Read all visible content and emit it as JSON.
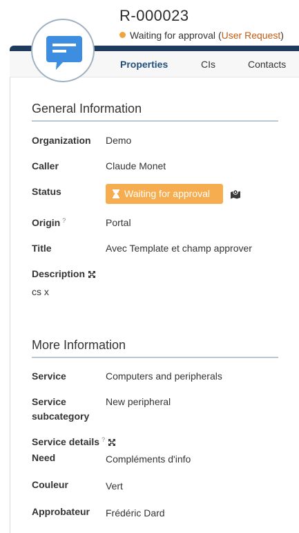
{
  "header": {
    "ref": "R-000023",
    "status_text": "Waiting for approval",
    "type_open": "(",
    "type_link": "User Request",
    "type_close": ")"
  },
  "tabs": [
    {
      "label": "Properties",
      "active": true
    },
    {
      "label": "CIs"
    },
    {
      "label": "Contacts"
    }
  ],
  "general": {
    "title": "General Information",
    "organization_label": "Organization",
    "organization_value": "Demo",
    "caller_label": "Caller",
    "caller_value": "Claude Monet",
    "status_label": "Status",
    "status_value": "Waiting for approval",
    "origin_label": "Origin",
    "origin_hint": "?",
    "origin_value": "Portal",
    "title_label": "Title",
    "title_value": "Avec Template et champ approver",
    "description_label": "Description",
    "description_value": "cs x"
  },
  "more": {
    "title": "More Information",
    "service_label": "Service",
    "service_value": "Computers and peripherals",
    "subcat_label_1": "Service",
    "subcat_label_2": "subcategory",
    "subcat_value": "New peripheral",
    "details_label": "Service details",
    "details_hint": "?",
    "need_label": "Need",
    "need_value": "Compléments d'info",
    "couleur_label": "Couleur",
    "couleur_value": "Vert",
    "approbateur_label": "Approbateur",
    "approbateur_value": "Frédéric Dard"
  },
  "icons": {
    "avatar": "chat-bubble-icon",
    "status": "hourglass-icon",
    "stimulus": "map-icon",
    "expand": "expand-icon"
  },
  "colors": {
    "link": "#c55a11",
    "badge": "#f6ad4f",
    "status_dot": "#f0a43b",
    "header_bar": "#1f3c5e",
    "avatar_blue": "#3d8ee0"
  }
}
